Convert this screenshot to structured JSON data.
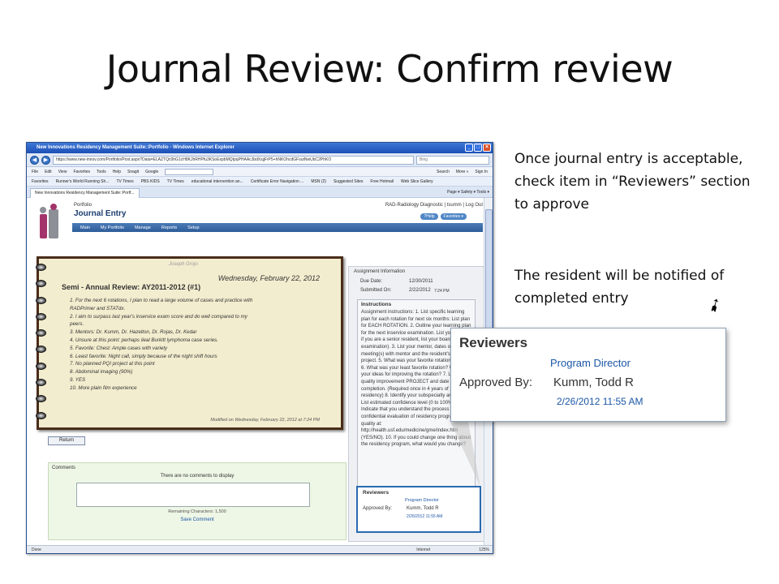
{
  "slide": {
    "title": "Journal Review:  Confirm review",
    "note1": "Once journal entry is acceptable, check item in “Reviewers” section to approve",
    "note2": "The resident will be notified of completed entry",
    "arrow": "➹"
  },
  "browser": {
    "title": "New Innovations Residency Management Suite::Portfolio - Windows Internet Explorer",
    "url": "https://www.new-innov.com/Portfolio/Post.aspx?Data=ELAZTQc0hG1cH8KJhRHPfu3KSoExpbMQIpqPHAAcJbdXsjjFrP5+hNKOhcdGFsutNwUbC2PhKO",
    "search_placeholder": "Bing",
    "menu": [
      "File",
      "Edit",
      "View",
      "Favorites",
      "Tools",
      "Help"
    ],
    "menu_right": [
      "Snagit",
      "Google",
      "Search",
      "More »",
      "Sign In"
    ],
    "favorites": [
      "Favorites",
      "Runner's World Running Sh...",
      "TV Times",
      "PBS KIDS",
      "TV Times",
      "educational intervention an...",
      "Certificate Error Navigation ...",
      "MSN (2)",
      "Suggested Sites",
      "Free Hotmail",
      "Web Slice Gallery"
    ],
    "tab": "New Innovations Residency Management Suite::Portf...",
    "tab_tools": "Page ▾  Safety ▾  Tools ▾",
    "status_left": "Done",
    "status_zone": "Internet",
    "zoom": "125%"
  },
  "app": {
    "breadcrumb": "Portfolio",
    "heading": "Journal Entry",
    "user_info": "RAD-Radiology Diagnostic | tsumm | Log Out",
    "help_label": "?Help",
    "favorites_label": "Favorites ▾",
    "nav": [
      "Main",
      "My Portfolio",
      "Manage",
      "Reports",
      "Setup"
    ]
  },
  "entry": {
    "author": "Joseph Grojo",
    "date": "Wednesday, February 22, 2012",
    "title": "Semi - Annual Review: AY2011-2012 (#1)",
    "items": [
      "1. For the next 6 rotations, I plan to read a large volume of cases and practice with",
      "RADPrimer and STATdx.",
      "2. I aim to surpass last year's inservice exam score and do well compared to my",
      "peers.",
      "3. Mentors: Dr. Kumm, Dr. Hazelton, Dr. Rojas, Dr. Kedar",
      "4. Unsure at this point: perhaps ileal Burkitt lymphoma case series.",
      "5. Favorite: Chest: Ample cases with variety",
      "6. Least favorite: Night call, simply because of the night shift hours",
      "7. No planned PQI project at this point",
      "8. Abdominal imaging (90%)",
      "9. YES",
      "10. More plain film experience"
    ],
    "modified": "Modified on Wednesday, February 22, 2012 at 7:24 PM",
    "return_label": "Return"
  },
  "comments": {
    "title": "Comments",
    "empty": "There are no comments to display",
    "remaining": "Remaining Characters: 1,500",
    "save": "Save Comment"
  },
  "assignment": {
    "title": "Assignment Information",
    "due_label": "Due Date:",
    "due_value": "12/30/2011",
    "submitted_label": "Submitted On:",
    "submitted_value": "2/22/2012",
    "submitted_time": "7:24 PM",
    "instructions_title": "Instructions",
    "instructions_text": "Assignment instructions: 1. List specific learning plan for each rotation for next six months: List plan for EACH ROTATION. 2. Outline your learning plan for the next inservice examination. List your goals if you are a senior resident, list your board examination). 3. List your mentor, dates of meeting(s) with mentor and the resident's day project. 5. What was your favorite rotation? Why? 6. What was your least favorite rotation? What are your ideas for improving the rotation? 7. List your quality improvement PROJECT and date of completion. (Required once in 4 years of residency) 8. Identify your subspecialty area(s). List estimated confidence level (0 to 100%) 9. Indicate that you understand the process for confidential evaluation of residency program quality at: http://health.usf.edu/medicine/gme/index.htm (YES/NO). 10. If you could change one thing about the residency program, what would you change?"
  },
  "reviewers": {
    "title": "Reviewers",
    "role": "Program Director",
    "approved_label": "Approved By:",
    "approver": "Kumm, Todd R",
    "approved_date": "2/26/2012 11:55 AM"
  },
  "colors": {
    "accent": "#1b56a6",
    "nav": "#2d5c99",
    "notebook_border": "#4a2d1a",
    "highlight_border": "#2a6bb0"
  }
}
